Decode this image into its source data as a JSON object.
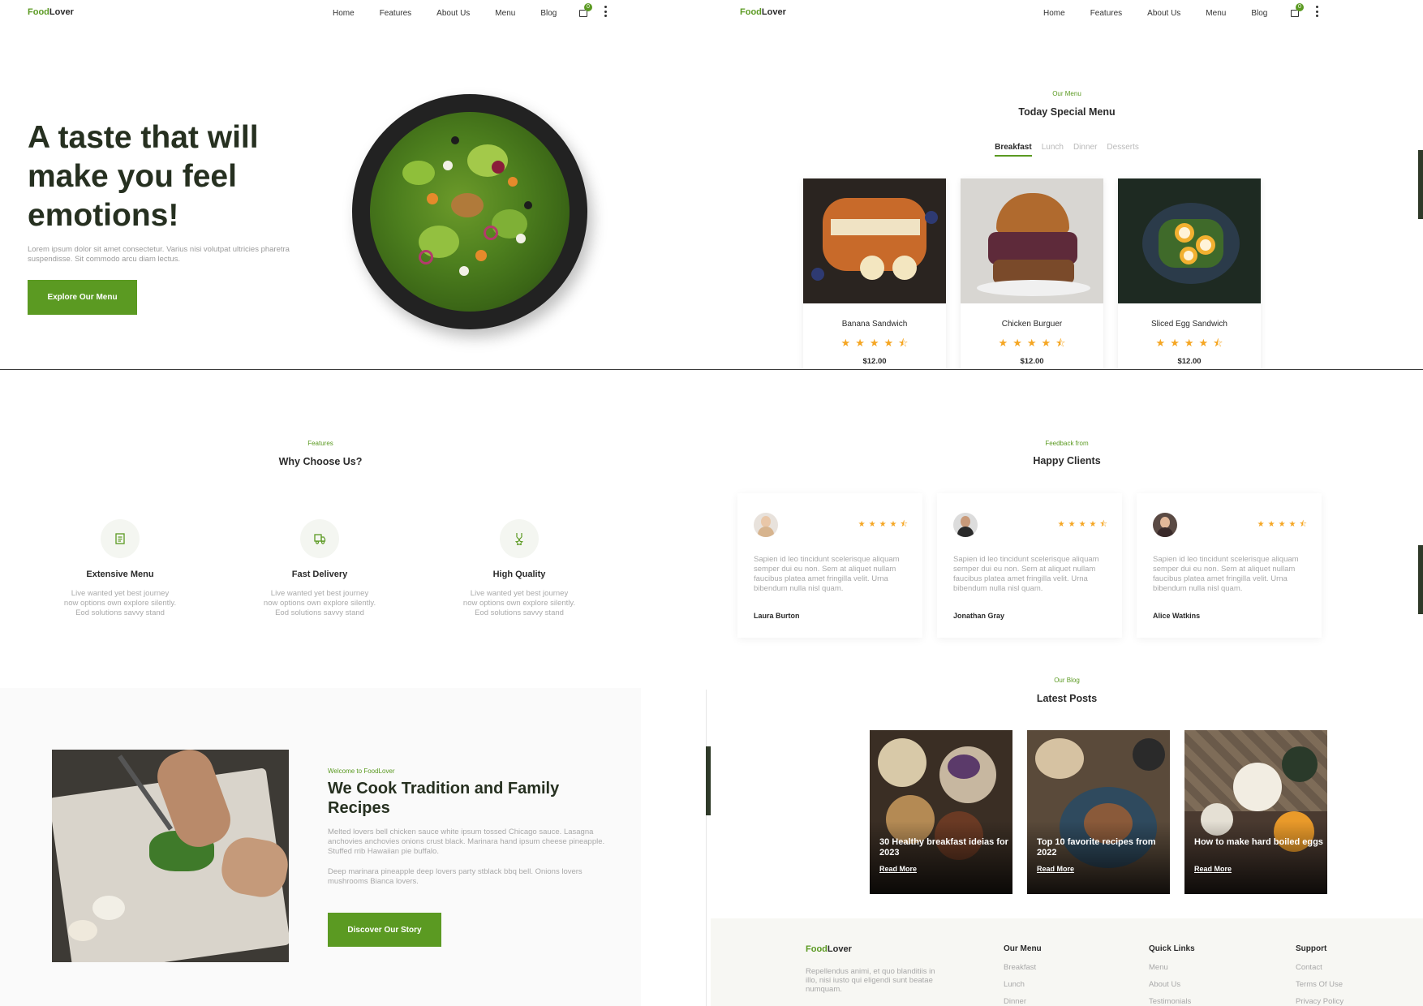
{
  "brand": {
    "part1": "Food",
    "part2": "Lover"
  },
  "nav": {
    "items": [
      "Home",
      "Features",
      "About Us",
      "Menu",
      "Blog"
    ],
    "cart_count": "0"
  },
  "hero": {
    "title": "A taste that will make you feel emotions!",
    "text": "Lorem ipsum dolor sit amet consectetur. Varius nisi volutpat ultricies pharetra suspendisse. Sit commodo arcu diam lectus.",
    "button": "Explore Our Menu"
  },
  "menu": {
    "kicker": "Our Menu",
    "title": "Today Special Menu",
    "tabs": [
      "Breakfast",
      "Lunch",
      "Dinner",
      "Desserts"
    ],
    "active_tab": "Breakfast",
    "items": [
      {
        "name": "Banana Sandwich",
        "price": "$12.00",
        "rating": 4.5
      },
      {
        "name": "Chicken Burguer",
        "price": "$12.00",
        "rating": 4.5
      },
      {
        "name": "Sliced Egg Sandwich",
        "price": "$12.00",
        "rating": 4.5
      }
    ]
  },
  "features": {
    "kicker": "Features",
    "title": "Why Choose Us?",
    "items": [
      {
        "icon": "menu-icon",
        "title": "Extensive Menu",
        "desc": "Live wanted yet best journey now options own explore silently. Eod solutions savvy stand"
      },
      {
        "icon": "delivery-icon",
        "title": "Fast Delivery",
        "desc": "Live wanted yet best journey now options own explore silently. Eod solutions savvy stand"
      },
      {
        "icon": "quality-icon",
        "title": "High Quality",
        "desc": "Live wanted yet best journey now options own explore silently. Eod solutions savvy stand"
      }
    ]
  },
  "clients": {
    "kicker": "Feedback from",
    "title": "Happy Clients",
    "items": [
      {
        "name": "Laura Burton",
        "quote": "Sapien id leo tincidunt scelerisque aliquam semper dui eu non. Sem at aliquet nullam faucibus platea amet fringilla velit. Urna bibendum nulla nisl quam.",
        "rating": 4.5
      },
      {
        "name": "Jonathan Gray",
        "quote": "Sapien id leo tincidunt scelerisque aliquam semper dui eu non. Sem at aliquet nullam faucibus platea amet fringilla velit. Urna bibendum nulla nisl quam.",
        "rating": 4.5
      },
      {
        "name": "Alice Watkins",
        "quote": "Sapien id leo tincidunt scelerisque aliquam semper dui eu non. Sem at aliquet nullam faucibus platea amet fringilla velit. Urna bibendum nulla nisl quam.",
        "rating": 4.5
      }
    ]
  },
  "about": {
    "kicker": "Welcome to FoodLover",
    "title": "We Cook Tradition and Family Recipes",
    "p1": "Melted lovers bell chicken sauce white ipsum tossed Chicago sauce. Lasagna anchovies anchovies onions crust black. Marinara hand ipsum cheese pineapple. Stuffed rrib Hawaiian pie buffalo.",
    "p2": "Deep marinara pineapple deep lovers party stblack bbq bell. Onions lovers mushrooms Bianca lovers.",
    "button": "Discover Our Story"
  },
  "blog": {
    "kicker": "Our Blog",
    "title": "Latest Posts",
    "read_more": "Read More",
    "posts": [
      {
        "title": "30 Healthy breakfast ideias for 2023"
      },
      {
        "title": "Top 10 favorite recipes from 2022"
      },
      {
        "title": "How to make hard boiled eggs"
      }
    ]
  },
  "footer": {
    "about": "Repellendus animi, et quo blanditiis in illo, nisi iusto qui eligendi sunt beatae numquam.",
    "columns": [
      {
        "heading": "Our Menu",
        "items": [
          "Breakfast",
          "Lunch",
          "Dinner"
        ]
      },
      {
        "heading": "Quick Links",
        "items": [
          "Menu",
          "About Us",
          "Testimonials"
        ]
      },
      {
        "heading": "Support",
        "items": [
          "Contact",
          "Terms Of Use",
          "Privacy Policy"
        ]
      }
    ]
  },
  "colors": {
    "accent": "#5b9a22",
    "dark": "#263020",
    "star": "#f5a623"
  }
}
